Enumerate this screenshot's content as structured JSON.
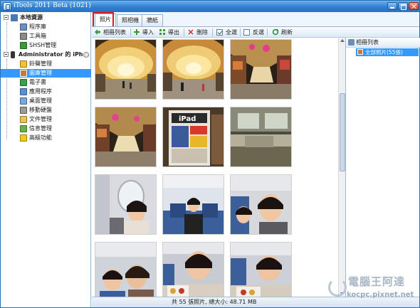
{
  "window": {
    "title": "iTools 2011 Beta (1021)",
    "accent": "#2f7fd1",
    "selection": "#3399ff"
  },
  "sidebar": {
    "local_resources": {
      "label": "本地資源",
      "items": [
        {
          "label": "程序庫",
          "icon": "library-icon"
        },
        {
          "label": "工具箱",
          "icon": "toolbox-icon"
        },
        {
          "label": "SHSH管理",
          "icon": "shsh-icon"
        }
      ]
    },
    "device": {
      "label": "Administrator 的 iPh...",
      "items": [
        {
          "label": "鈴聲管理",
          "icon": "ringtone-icon"
        },
        {
          "label": "圖庫管理",
          "icon": "photo-library-icon",
          "selected": true
        },
        {
          "label": "電子書",
          "icon": "ebook-icon"
        },
        {
          "label": "應用程序",
          "icon": "apps-icon"
        },
        {
          "label": "桌面管理",
          "icon": "desktop-icon"
        },
        {
          "label": "移動硬盤",
          "icon": "disk-icon"
        },
        {
          "label": "文件管理",
          "icon": "folder-icon"
        },
        {
          "label": "信息管理",
          "icon": "message-icon"
        },
        {
          "label": "高級功能",
          "icon": "star-icon"
        }
      ]
    }
  },
  "tabs": [
    {
      "label": "照片",
      "active": true
    },
    {
      "label": "照相機",
      "active": false
    },
    {
      "label": "牆紙",
      "active": false
    }
  ],
  "toolbar": {
    "album_list": "相冊列表",
    "import": "導入",
    "export": "導出",
    "delete": "刪除",
    "select_all": "全選",
    "invert": "反選",
    "refresh": "刷新"
  },
  "right_panel": {
    "header": "相冊列表",
    "item": "全部照片(55張)"
  },
  "status": {
    "text": "共 55 張照片, 總大小: 48.71 MB"
  },
  "photos": [
    "station-hall-arches-1",
    "station-hall-arches-2",
    "station-hall-shops-1",
    "station-hall-shops-2",
    "ipad-magazine-stand",
    "airport-window-view",
    "girl-airplane-window",
    "girl-airplane-cabin",
    "girl-airplane-seat",
    "girl-meal-tray",
    "girl-closeup-cabin",
    "girl-meal-tray-2"
  ],
  "watermark": {
    "line1": "電腦王阿達",
    "line2": "kocpc.pixnet.net"
  }
}
